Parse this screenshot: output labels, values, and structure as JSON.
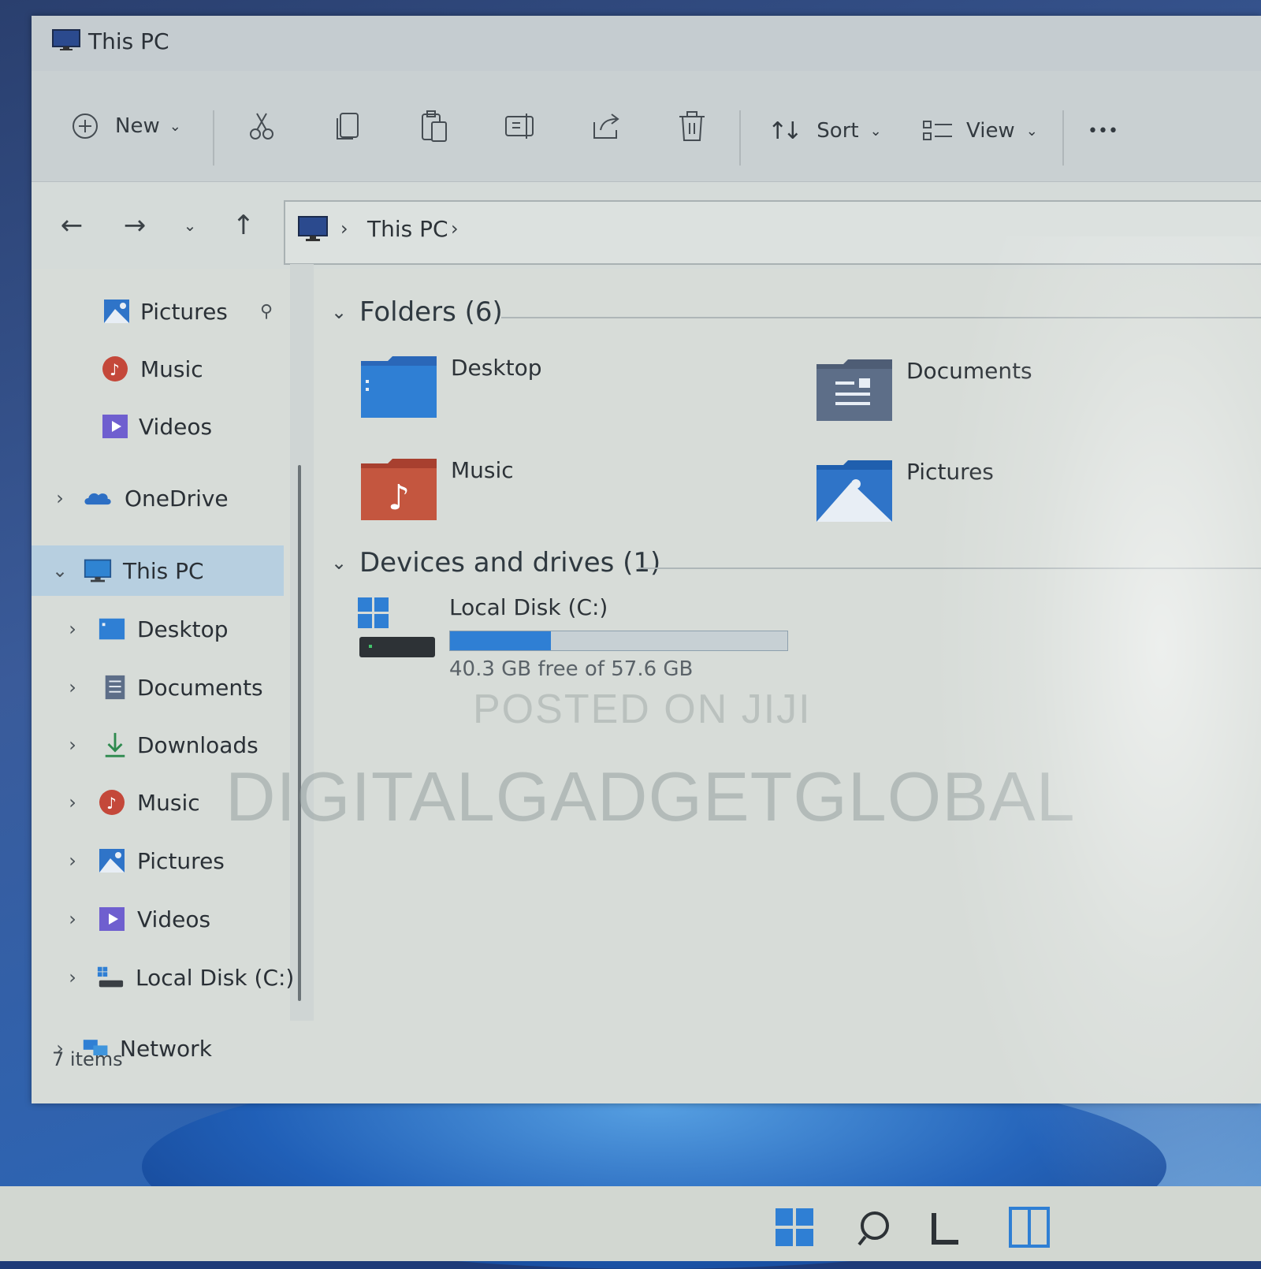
{
  "window": {
    "title": "This PC"
  },
  "toolbar": {
    "new_label": "New",
    "sort_label": "Sort",
    "view_label": "View",
    "more_label": "•••"
  },
  "address": {
    "segments": [
      "This PC"
    ]
  },
  "sidebar": {
    "items": [
      {
        "label": "Pictures",
        "icon": "pictures-icon",
        "pinned": true
      },
      {
        "label": "Music",
        "icon": "music-icon"
      },
      {
        "label": "Videos",
        "icon": "videos-icon"
      },
      {
        "label": "OneDrive",
        "icon": "onedrive-icon",
        "expandable": true
      },
      {
        "label": "This PC",
        "icon": "this-pc-icon",
        "expanded": true,
        "selected": true
      },
      {
        "label": "Desktop",
        "icon": "desktop-icon",
        "expandable": true
      },
      {
        "label": "Documents",
        "icon": "documents-icon",
        "expandable": true
      },
      {
        "label": "Downloads",
        "icon": "downloads-icon",
        "expandable": true
      },
      {
        "label": "Music",
        "icon": "music-icon",
        "expandable": true
      },
      {
        "label": "Pictures",
        "icon": "pictures-icon",
        "expandable": true
      },
      {
        "label": "Videos",
        "icon": "videos-icon",
        "expandable": true
      },
      {
        "label": "Local Disk (C:)",
        "icon": "drive-icon",
        "expandable": true
      },
      {
        "label": "Network",
        "icon": "network-icon",
        "expandable": true
      }
    ]
  },
  "content": {
    "folders_header": "Folders (6)",
    "folders": [
      {
        "label": "Desktop",
        "icon": "desktop-folder-icon"
      },
      {
        "label": "Documents",
        "icon": "documents-folder-icon"
      },
      {
        "label": "Music",
        "icon": "music-folder-icon"
      },
      {
        "label": "Pictures",
        "icon": "pictures-folder-icon"
      }
    ],
    "drives_header": "Devices and drives (1)",
    "drive": {
      "label": "Local Disk (C:)",
      "free_text": "40.3 GB free of 57.6 GB",
      "used_fraction": 0.3
    }
  },
  "status": {
    "items": "7 items"
  },
  "watermark": {
    "line1": "POSTED ON JIJI",
    "line2": "DIGITALGADGETGLOBAL"
  },
  "colors": {
    "accent": "#2f7fd4",
    "selected": "#b7cfe0"
  }
}
